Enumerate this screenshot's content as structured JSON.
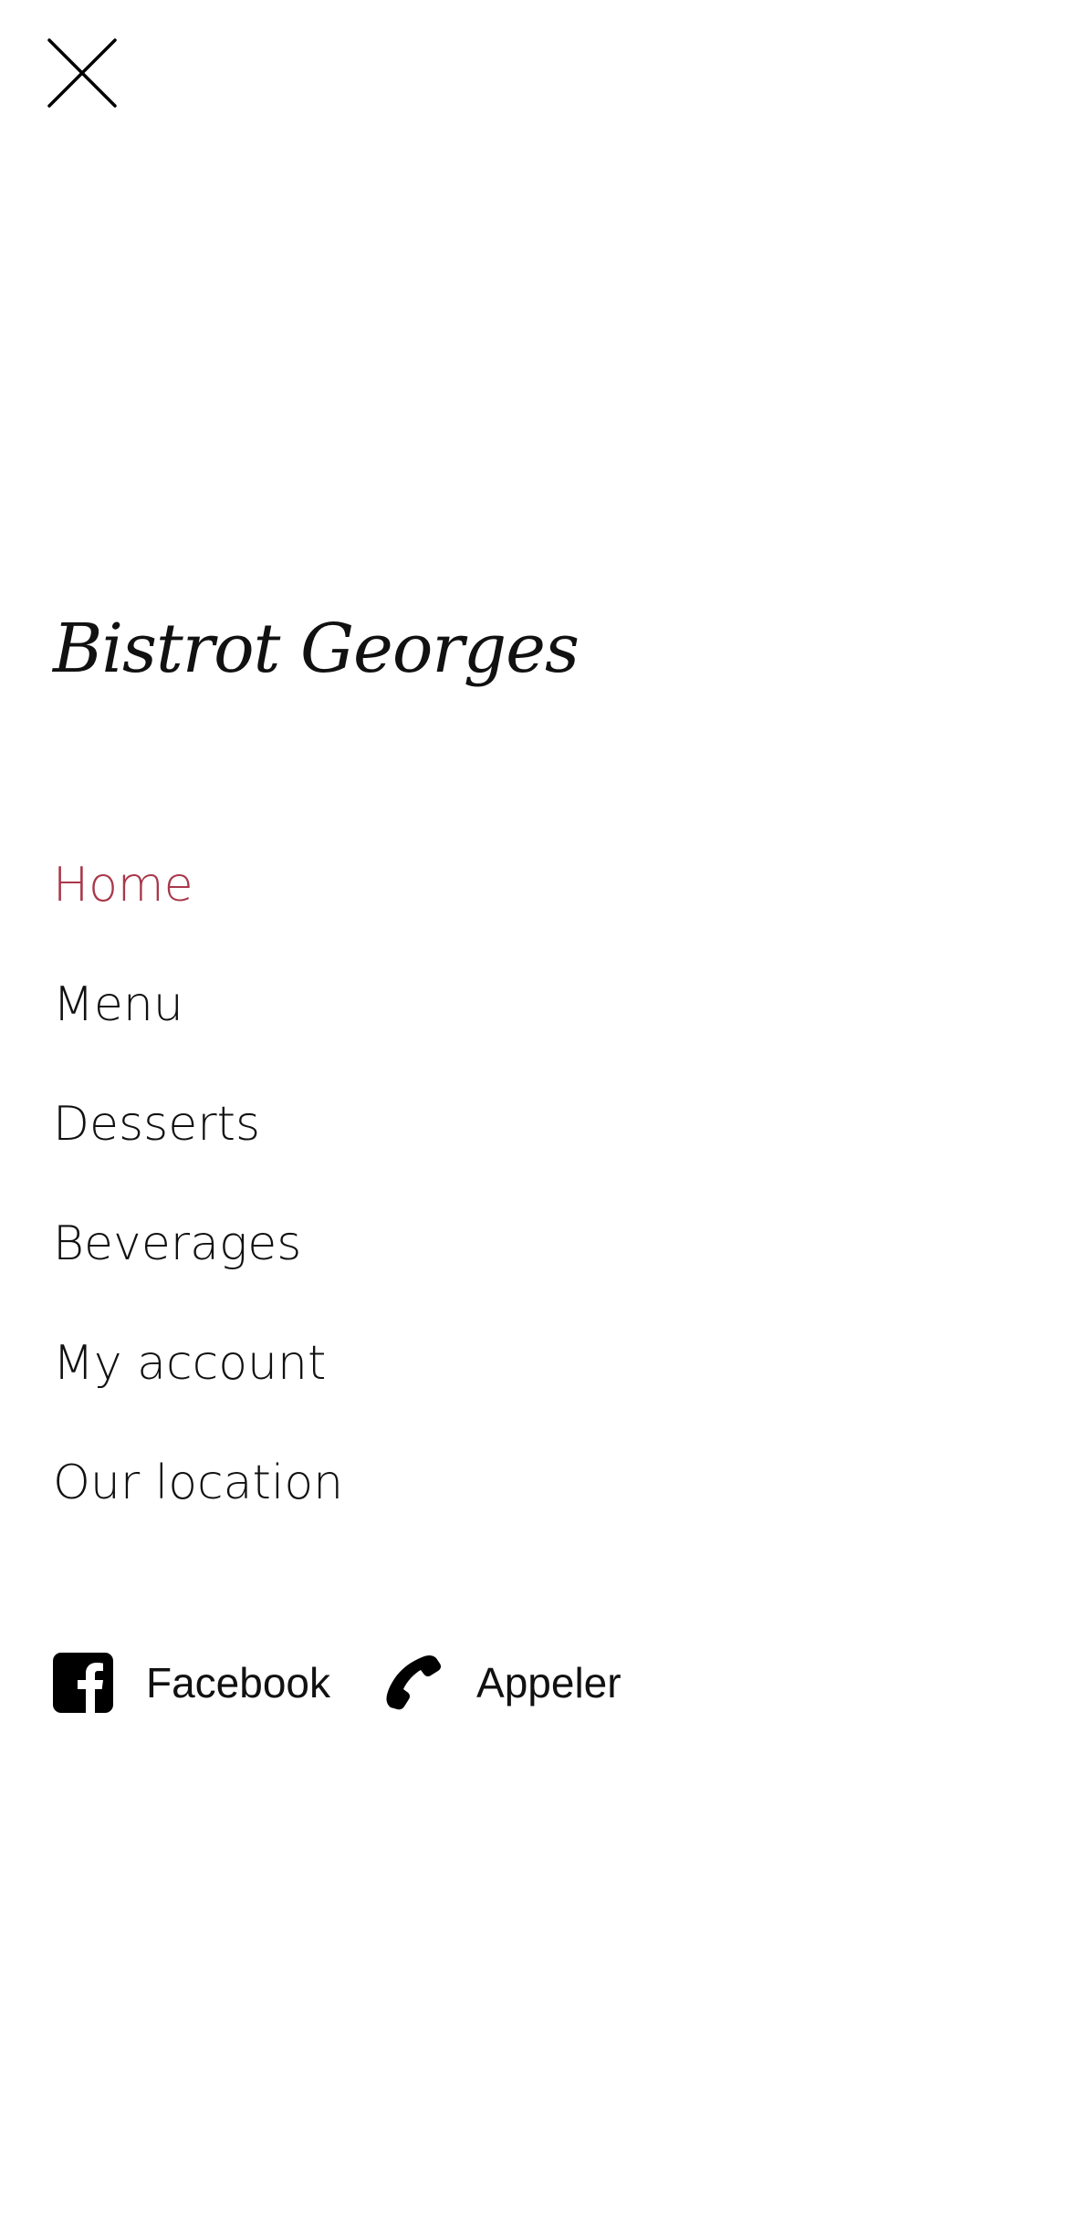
{
  "close": {
    "icon": "close-icon",
    "aria_label": "Close menu"
  },
  "logo": {
    "text": "Bistrot Georges"
  },
  "nav": {
    "items": [
      {
        "label": "Home",
        "active": true
      },
      {
        "label": "Menu",
        "active": false
      },
      {
        "label": "Desserts",
        "active": false
      },
      {
        "label": "Beverages",
        "active": false
      },
      {
        "label": "My account",
        "active": false
      },
      {
        "label": "Our location",
        "active": false
      }
    ]
  },
  "contact": {
    "facebook": {
      "label": "Facebook",
      "icon": "facebook-icon"
    },
    "call": {
      "label": "Appeler",
      "icon": "phone-icon"
    }
  },
  "colors": {
    "active_link": "#a8384a",
    "text": "#111111",
    "background": "#ffffff"
  }
}
